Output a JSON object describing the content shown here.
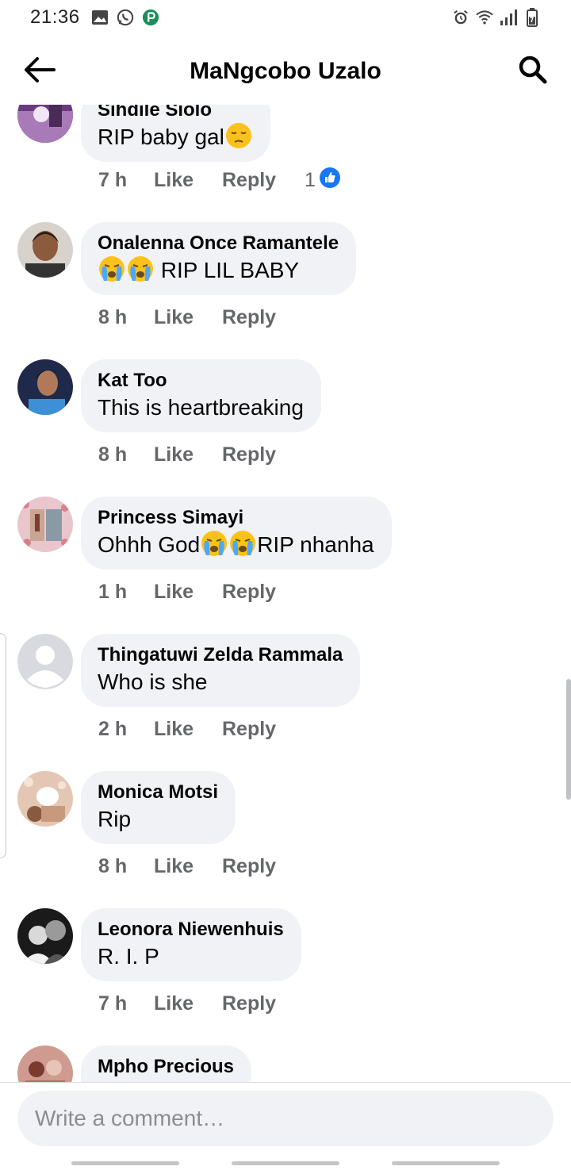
{
  "status_bar": {
    "time": "21:36"
  },
  "header": {
    "title": "MaNgcobo Uzalo"
  },
  "comments": [
    {
      "name": "Sihdile Siolo",
      "text": "RIP baby gal",
      "emoji": "pensive-face",
      "time": "7 h",
      "like": "Like",
      "reply": "Reply",
      "reaction_count": "1"
    },
    {
      "name": "Onalenna Once Ramantele",
      "emoji": "crying-face",
      "text": "RIP LIL BABY",
      "time": "8 h",
      "like": "Like",
      "reply": "Reply"
    },
    {
      "name": "Kat Too",
      "text": "This is heartbreaking",
      "time": "8 h",
      "like": "Like",
      "reply": "Reply"
    },
    {
      "name": "Princess Simayi",
      "text_before": "Ohhh God",
      "emoji": "crying-face",
      "text_after": "RIP nhanha",
      "time": "1 h",
      "like": "Like",
      "reply": "Reply"
    },
    {
      "name": "Thingatuwi Zelda Rammala",
      "text": "Who is she",
      "time": "2 h",
      "like": "Like",
      "reply": "Reply"
    },
    {
      "name": "Monica Motsi",
      "text": "Rip",
      "time": "8 h",
      "like": "Like",
      "reply": "Reply"
    },
    {
      "name": "Leonora Niewenhuis",
      "text": "R. I. P",
      "time": "7 h",
      "like": "Like",
      "reply": "Reply"
    },
    {
      "name": "Mpho Precious"
    }
  ],
  "composer": {
    "placeholder": "Write a comment…"
  },
  "colors": {
    "bubble": "#f0f2f5",
    "meta_text": "#65676b",
    "like_blue": "#1877f2"
  }
}
